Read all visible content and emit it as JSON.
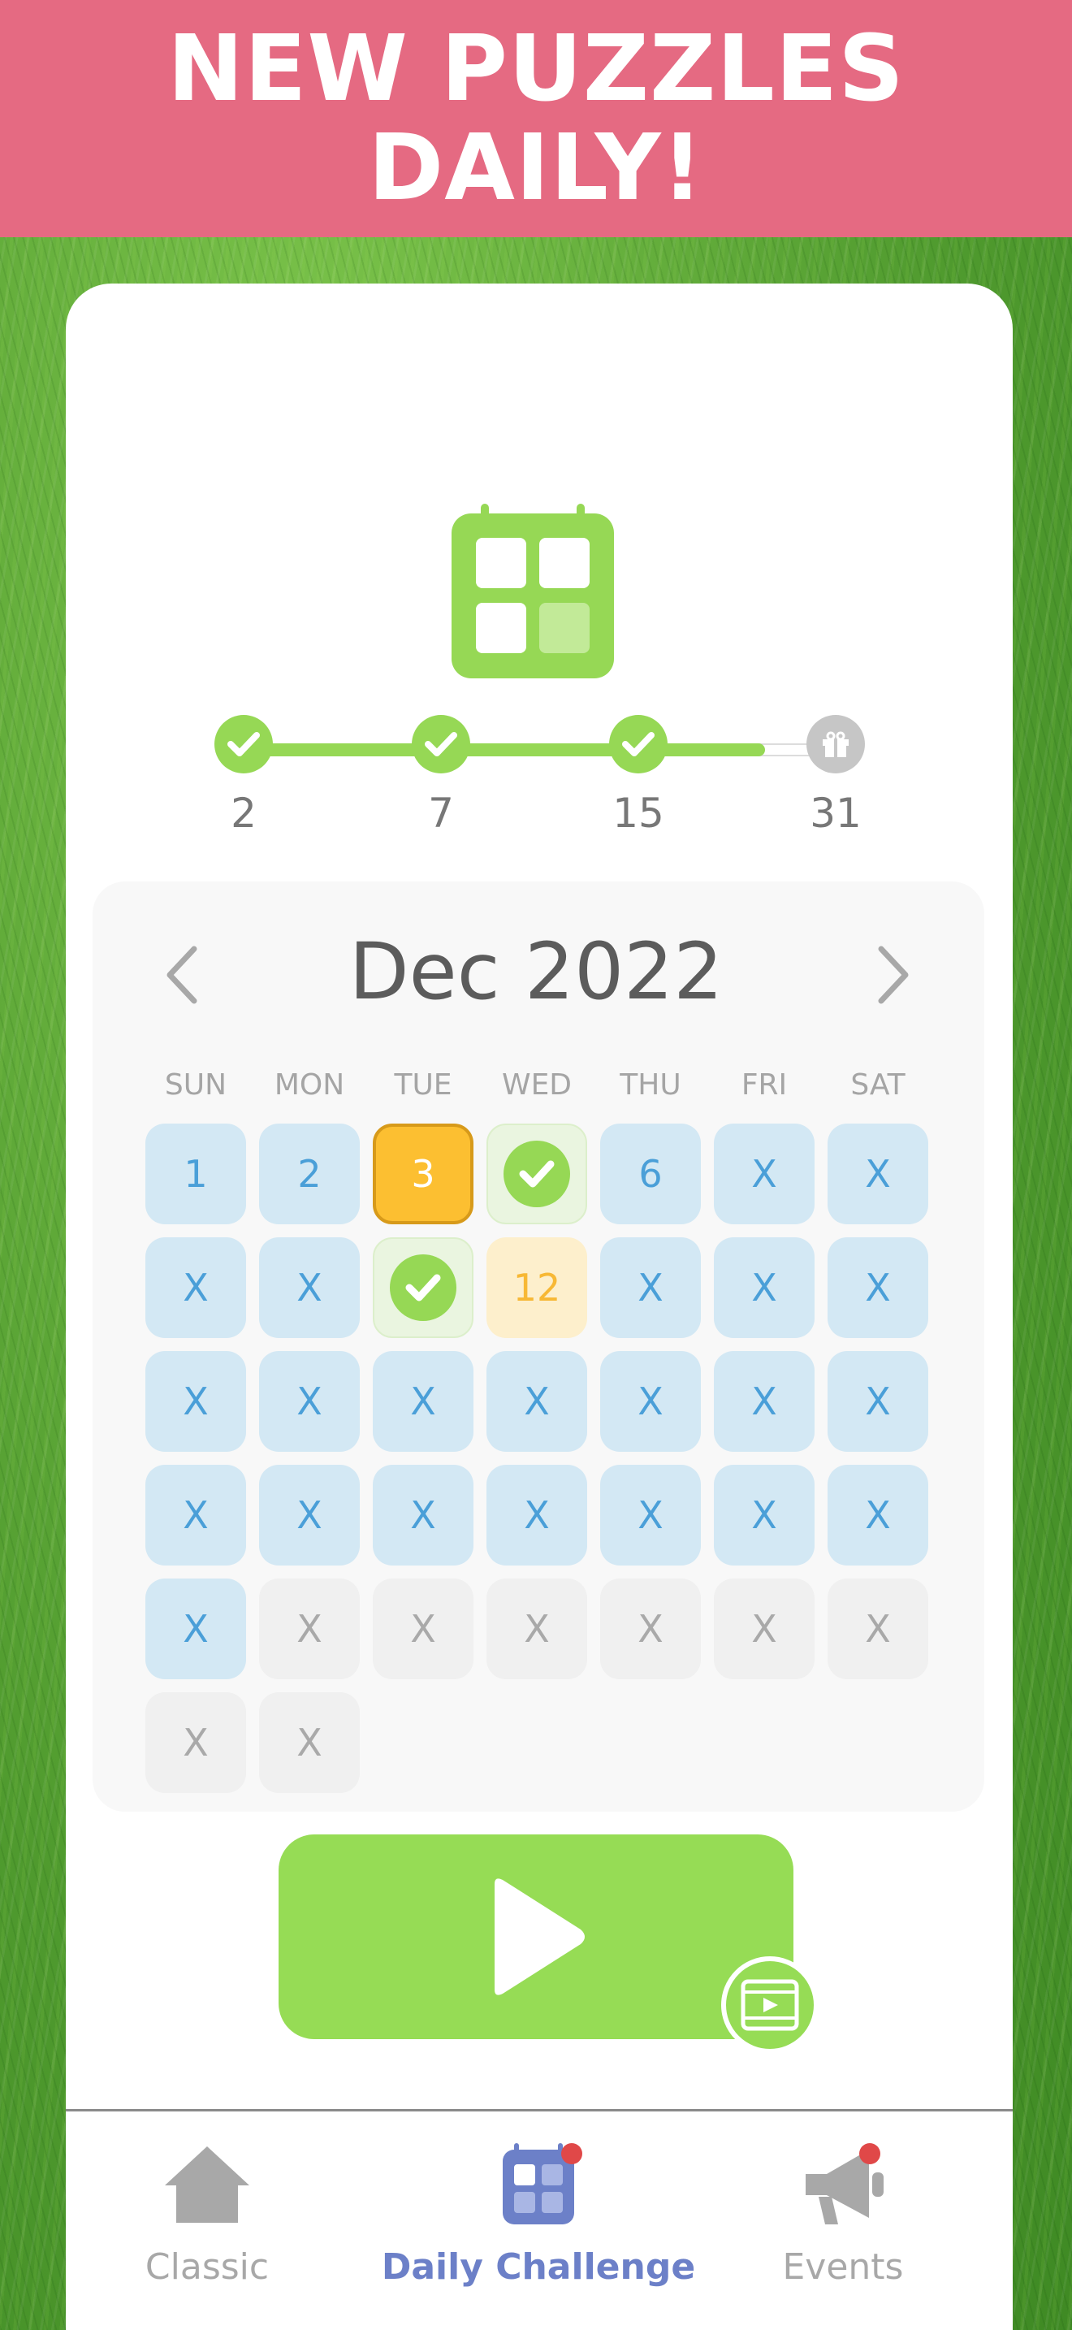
{
  "banner": {
    "title": "NEW PUZZLES\nDAILY!"
  },
  "colors": {
    "banner": "#e56a82",
    "accent_green": "#96d855",
    "open_day": "#d3e8f4",
    "today": "#fcbf31",
    "active_tab": "#6c80c8",
    "notification": "#e04848"
  },
  "progress": {
    "fill_fraction": 0.88,
    "milestones": [
      {
        "label": "2",
        "state": "done",
        "icon": "check-icon"
      },
      {
        "label": "7",
        "state": "done",
        "icon": "check-icon"
      },
      {
        "label": "15",
        "state": "done",
        "icon": "check-icon"
      },
      {
        "label": "31",
        "state": "locked",
        "icon": "gift-icon"
      }
    ]
  },
  "calendar": {
    "month": "Dec 2022",
    "prev_icon": "chevron-left-icon",
    "next_icon": "chevron-right-icon",
    "weekdays": [
      "SUN",
      "MON",
      "TUE",
      "WED",
      "THU",
      "FRI",
      "SAT"
    ],
    "weeks": [
      [
        {
          "text": "1",
          "state": "open"
        },
        {
          "text": "2",
          "state": "open"
        },
        {
          "text": "3",
          "state": "today"
        },
        {
          "text": "",
          "state": "done"
        },
        {
          "text": "6",
          "state": "open"
        },
        {
          "text": "X",
          "state": "open"
        },
        {
          "text": "X",
          "state": "open"
        }
      ],
      [
        {
          "text": "X",
          "state": "open"
        },
        {
          "text": "X",
          "state": "open"
        },
        {
          "text": "",
          "state": "done"
        },
        {
          "text": "12",
          "state": "selected"
        },
        {
          "text": "X",
          "state": "open"
        },
        {
          "text": "X",
          "state": "open"
        },
        {
          "text": "X",
          "state": "open"
        }
      ],
      [
        {
          "text": "X",
          "state": "open"
        },
        {
          "text": "X",
          "state": "open"
        },
        {
          "text": "X",
          "state": "open"
        },
        {
          "text": "X",
          "state": "open"
        },
        {
          "text": "X",
          "state": "open"
        },
        {
          "text": "X",
          "state": "open"
        },
        {
          "text": "X",
          "state": "open"
        }
      ],
      [
        {
          "text": "X",
          "state": "open"
        },
        {
          "text": "X",
          "state": "open"
        },
        {
          "text": "X",
          "state": "open"
        },
        {
          "text": "X",
          "state": "open"
        },
        {
          "text": "X",
          "state": "open"
        },
        {
          "text": "X",
          "state": "open"
        },
        {
          "text": "X",
          "state": "open"
        }
      ],
      [
        {
          "text": "X",
          "state": "open"
        },
        {
          "text": "X",
          "state": "future"
        },
        {
          "text": "X",
          "state": "future"
        },
        {
          "text": "X",
          "state": "future"
        },
        {
          "text": "X",
          "state": "future"
        },
        {
          "text": "X",
          "state": "future"
        },
        {
          "text": "X",
          "state": "future"
        }
      ],
      [
        {
          "text": "X",
          "state": "future"
        },
        {
          "text": "X",
          "state": "future"
        }
      ]
    ]
  },
  "play": {
    "icon": "play-icon",
    "badge_icon": "video-icon"
  },
  "tabs": [
    {
      "label": "Classic",
      "icon": "home-icon",
      "active": false,
      "notification": false
    },
    {
      "label": "Daily Challenge",
      "icon": "calendar-icon",
      "active": true,
      "notification": true
    },
    {
      "label": "Events",
      "icon": "megaphone-icon",
      "active": false,
      "notification": true
    }
  ]
}
